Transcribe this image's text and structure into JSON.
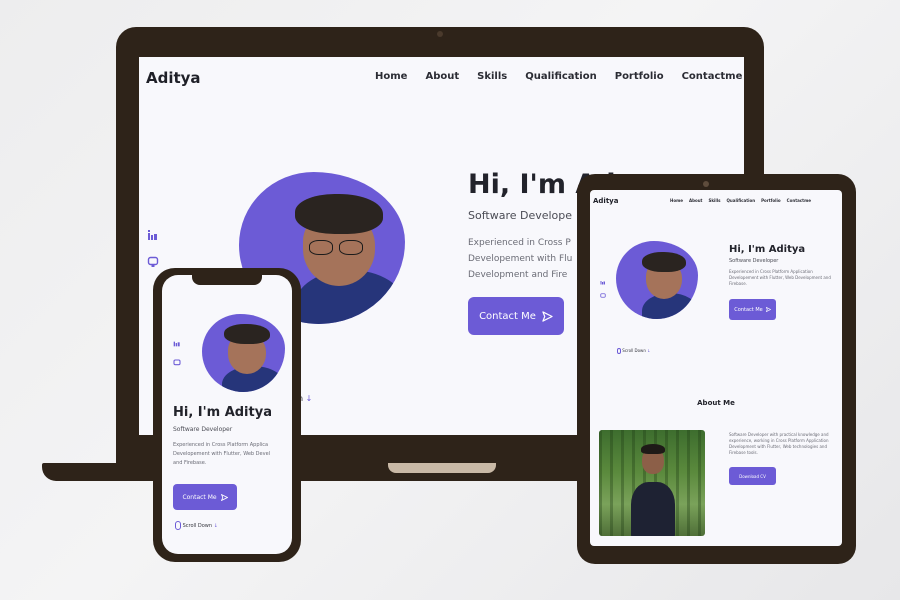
{
  "brand": "Aditya",
  "accent_color": "#6c5bd6",
  "device_color": "#2e2319",
  "nav": [
    "Home",
    "About",
    "Skills",
    "Qualification",
    "Portfolio",
    "Contactme"
  ],
  "hero": {
    "title": "Hi, I'm Aditya",
    "title_laptop_visible": "Hi, I'm Ad",
    "subtitle": "Software Developer",
    "subtitle_laptop_visible": "Software Develope",
    "description": "Experienced in Cross Platform Application Developement with Flutter, Web Development and Firebase.",
    "description_laptop_lines": [
      "Experienced in Cross P",
      "Developement with Flu",
      "Development and Fire"
    ],
    "description_phone_lines": [
      "Experienced in Cross Platform Applica",
      "Developement with Flutter, Web Devel",
      "and Firebase."
    ],
    "cta_label": "Contact Me",
    "cta_icon": "send-icon",
    "scroll_label": "Scroll Down",
    "scroll_laptop_visible": "n"
  },
  "social_icons": [
    "linkedin-icon",
    "github-icon"
  ],
  "about": {
    "heading": "About Me",
    "description": "Software Developer with practical knowledge and experience, working in Cross Platform Application Development with Flutter, Web technologies and Firebase tools.",
    "download_label": "Download CV"
  }
}
